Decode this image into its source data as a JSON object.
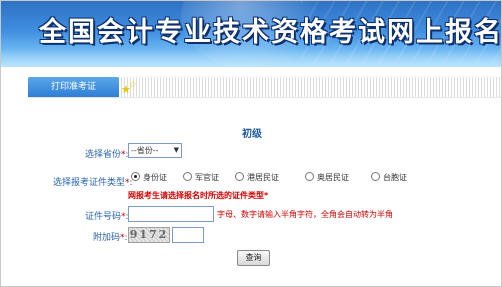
{
  "banner": {
    "title": "全国会计专业技术资格考试网上报名系统"
  },
  "tabs": {
    "active_label": "打印准考证"
  },
  "form": {
    "level": "初级",
    "province_label": "选择省份",
    "province_value": "--省份--",
    "cert_type_label": "选择报考证件类型",
    "cert_options": [
      "身份证",
      "军官证",
      "港居民证",
      "奥居民证",
      "台胞证"
    ],
    "warning": "网报考生请选择报名时所选的证件类型*",
    "id_label": "证件号码",
    "id_hint": "字母、数字请输入半角字符，全角会自动转为半角",
    "captcha_label": "附加码",
    "captcha_text": "9172",
    "required_mark": "*",
    "colon": ":",
    "query_button": "查询"
  }
}
